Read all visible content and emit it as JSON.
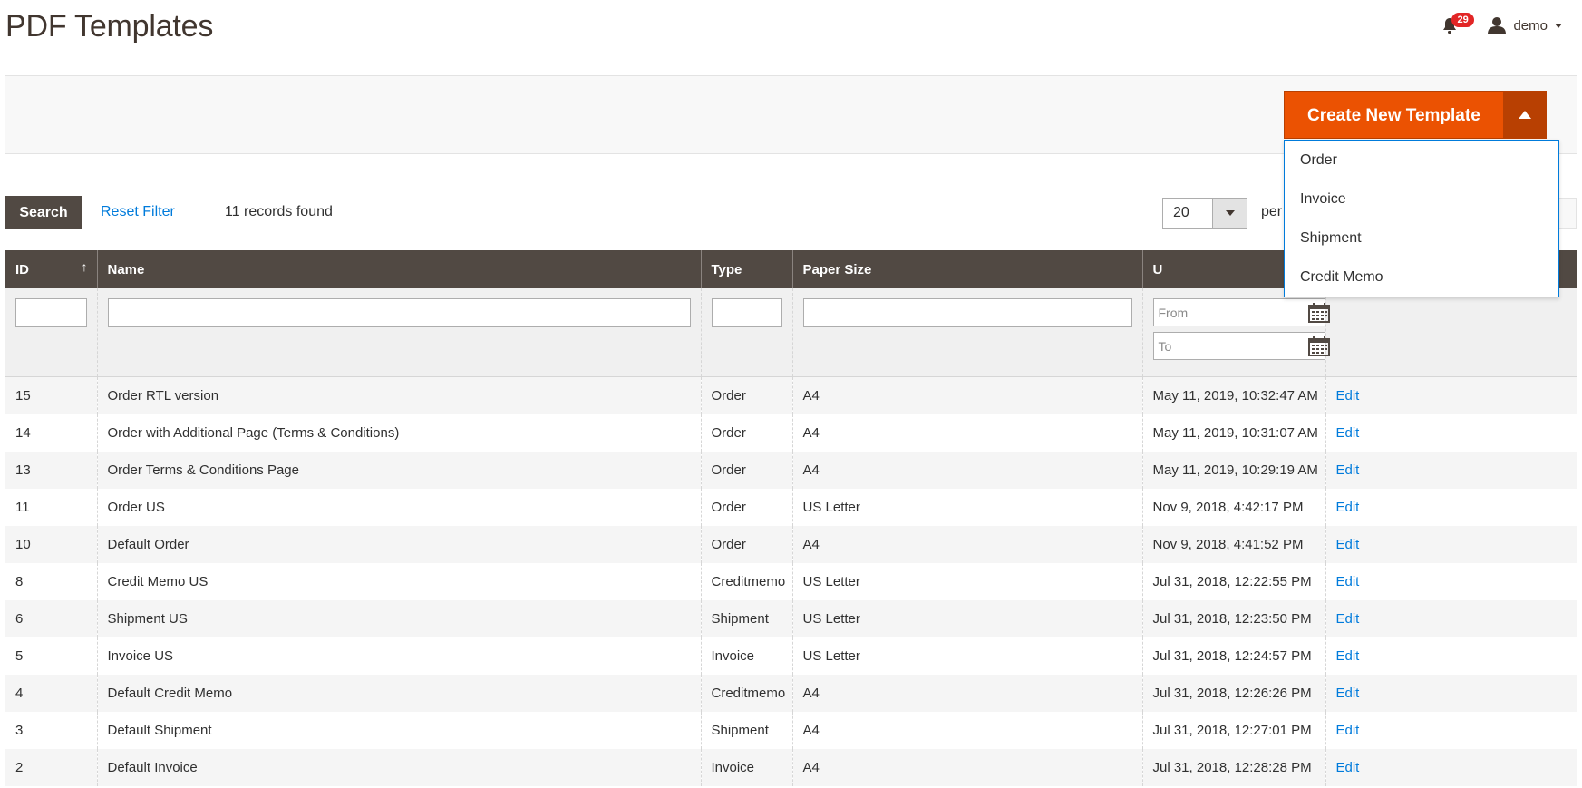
{
  "page": {
    "title": "PDF Templates"
  },
  "header": {
    "notification_count": "29",
    "username": "demo"
  },
  "actions": {
    "create_label": "Create New Template",
    "create_options": [
      "Order",
      "Invoice",
      "Shipment",
      "Credit Memo"
    ]
  },
  "toolbar": {
    "search_label": "Search",
    "reset_label": "Reset Filter",
    "records_found": "11 records found",
    "page_size": "20",
    "per_page_label": "per"
  },
  "grid": {
    "columns": [
      "ID",
      "Name",
      "Type",
      "Paper Size",
      "U",
      ""
    ],
    "date_filter": {
      "from_placeholder": "From",
      "to_placeholder": "To"
    },
    "edit_label": "Edit",
    "rows": [
      {
        "id": "15",
        "name": "Order RTL version",
        "type": "Order",
        "paper": "A4",
        "updated": "May 11, 2019, 10:32:47 AM"
      },
      {
        "id": "14",
        "name": "Order with Additional Page (Terms & Conditions)",
        "type": "Order",
        "paper": "A4",
        "updated": "May 11, 2019, 10:31:07 AM"
      },
      {
        "id": "13",
        "name": "Order Terms & Conditions Page",
        "type": "Order",
        "paper": "A4",
        "updated": "May 11, 2019, 10:29:19 AM"
      },
      {
        "id": "11",
        "name": "Order US",
        "type": "Order",
        "paper": "US Letter",
        "updated": "Nov 9, 2018, 4:42:17 PM"
      },
      {
        "id": "10",
        "name": "Default Order",
        "type": "Order",
        "paper": "A4",
        "updated": "Nov 9, 2018, 4:41:52 PM"
      },
      {
        "id": "8",
        "name": "Credit Memo US",
        "type": "Creditmemo",
        "paper": "US Letter",
        "updated": "Jul 31, 2018, 12:22:55 PM"
      },
      {
        "id": "6",
        "name": "Shipment US",
        "type": "Shipment",
        "paper": "US Letter",
        "updated": "Jul 31, 2018, 12:23:50 PM"
      },
      {
        "id": "5",
        "name": "Invoice US",
        "type": "Invoice",
        "paper": "US Letter",
        "updated": "Jul 31, 2018, 12:24:57 PM"
      },
      {
        "id": "4",
        "name": "Default Credit Memo",
        "type": "Creditmemo",
        "paper": "A4",
        "updated": "Jul 31, 2018, 12:26:26 PM"
      },
      {
        "id": "3",
        "name": "Default Shipment",
        "type": "Shipment",
        "paper": "A4",
        "updated": "Jul 31, 2018, 12:27:01 PM"
      },
      {
        "id": "2",
        "name": "Default Invoice",
        "type": "Invoice",
        "paper": "A4",
        "updated": "Jul 31, 2018, 12:28:28 PM"
      }
    ]
  },
  "colors": {
    "accent": "#eb5202",
    "accent_dark": "#b84002",
    "header_bg": "#514943",
    "link": "#007bdb",
    "badge": "#e22626"
  }
}
